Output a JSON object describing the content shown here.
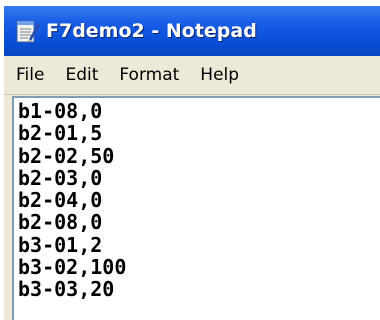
{
  "window": {
    "title": "F7demo2 - Notepad"
  },
  "menu": {
    "items": [
      "File",
      "Edit",
      "Format",
      "Help"
    ]
  },
  "editor": {
    "lines": [
      "b1-08,0",
      "b2-01,5",
      "b2-02,50",
      "b2-03,0",
      "b2-04,0",
      "b2-08,0",
      "b3-01,2",
      "b3-02,100",
      "b3-03,20"
    ]
  },
  "colors": {
    "titlebar": "#0a4fd8",
    "menubar": "#ece9d8",
    "editor_bg": "#ffffff"
  },
  "icons": {
    "app": "notepad-icon"
  }
}
